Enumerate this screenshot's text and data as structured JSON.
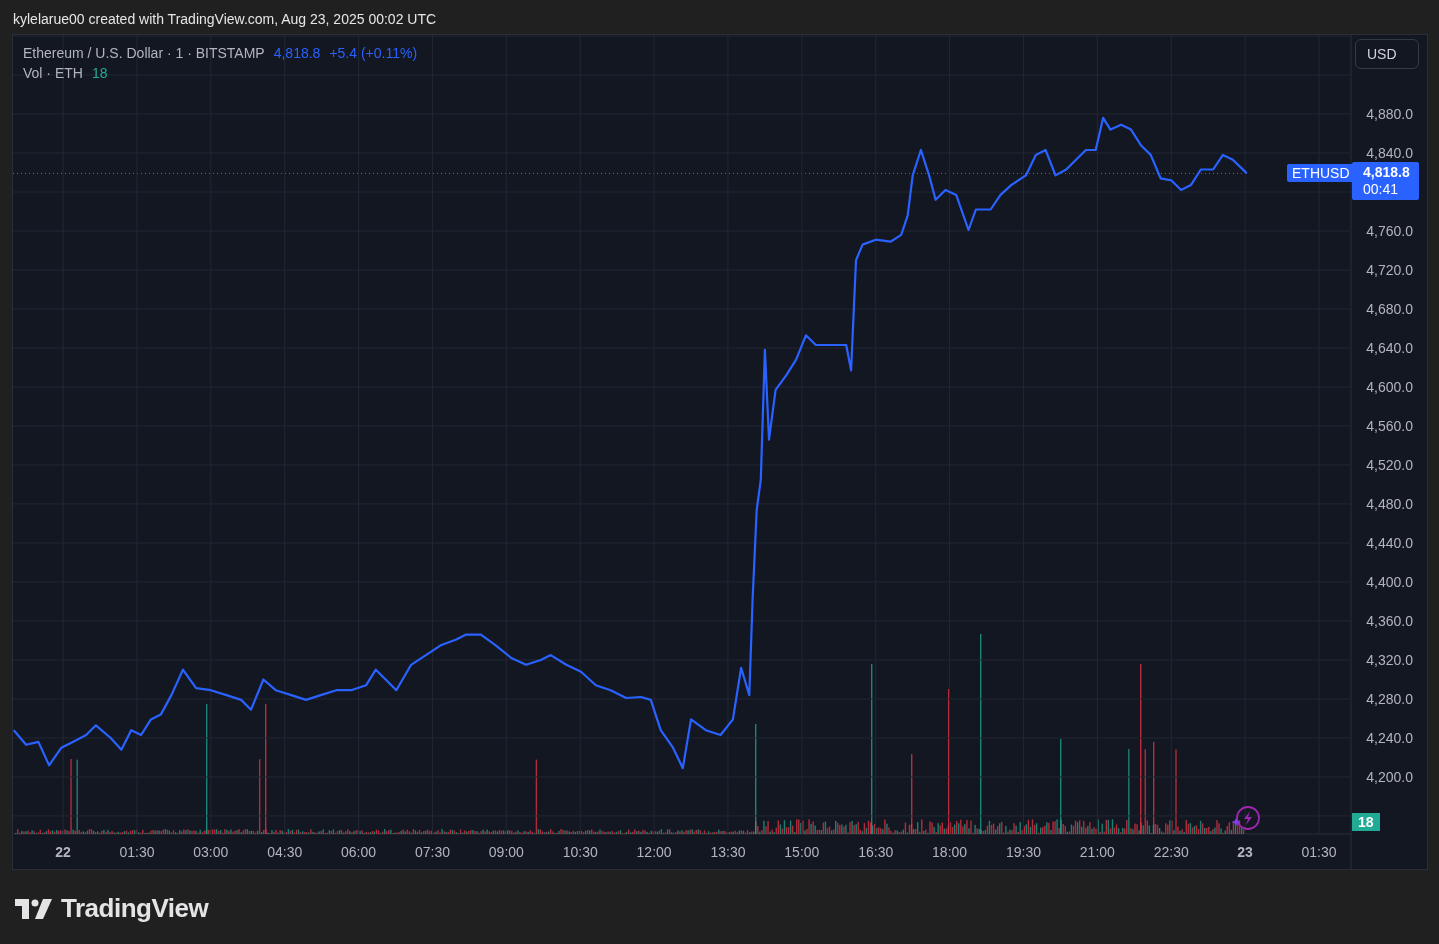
{
  "header": {
    "text": "kylelarue00 created with TradingView.com, Aug 23, 2025 00:02 UTC"
  },
  "legend": {
    "title": "Ethereum / U.S. Dollar · 1 · BITSTAMP",
    "price": "4,818.8",
    "change": "+5.4 (+0.11%)",
    "volume_label": "Vol · ETH",
    "volume_value": "18"
  },
  "currency_button": "USD",
  "price_line": {
    "price": "4,818.8",
    "countdown": "00:41"
  },
  "volume_badge": "18",
  "chart_data": {
    "type": "line",
    "grid": true,
    "xlim": [
      "2025-08-21T22:59",
      "2025-08-23T02:09"
    ],
    "ylim": [
      4141.5,
      4961
    ],
    "xticks": [
      {
        "value": "2025-08-22T00:00",
        "label": "22"
      },
      {
        "value": "2025-08-22T01:30",
        "label": "01:30"
      },
      {
        "value": "2025-08-22T03:00",
        "label": "03:00"
      },
      {
        "value": "2025-08-22T04:30",
        "label": "04:30"
      },
      {
        "value": "2025-08-22T06:00",
        "label": "06:00"
      },
      {
        "value": "2025-08-22T07:30",
        "label": "07:30"
      },
      {
        "value": "2025-08-22T09:00",
        "label": "09:00"
      },
      {
        "value": "2025-08-22T10:30",
        "label": "10:30"
      },
      {
        "value": "2025-08-22T12:00",
        "label": "12:00"
      },
      {
        "value": "2025-08-22T13:30",
        "label": "13:30"
      },
      {
        "value": "2025-08-22T15:00",
        "label": "15:00"
      },
      {
        "value": "2025-08-22T16:30",
        "label": "16:30"
      },
      {
        "value": "2025-08-22T18:00",
        "label": "18:00"
      },
      {
        "value": "2025-08-22T19:30",
        "label": "19:30"
      },
      {
        "value": "2025-08-22T21:00",
        "label": "21:00"
      },
      {
        "value": "2025-08-22T22:30",
        "label": "22:30"
      },
      {
        "value": "2025-08-23T00:00",
        "label": "23"
      },
      {
        "value": "2025-08-23T01:30",
        "label": "01:30"
      }
    ],
    "yticks": [
      {
        "value": 4200,
        "label": "4,200.0"
      },
      {
        "value": 4240,
        "label": "4,240.0"
      },
      {
        "value": 4280,
        "label": "4,280.0"
      },
      {
        "value": 4320,
        "label": "4,320.0"
      },
      {
        "value": 4360,
        "label": "4,360.0"
      },
      {
        "value": 4400,
        "label": "4,400.0"
      },
      {
        "value": 4440,
        "label": "4,440.0"
      },
      {
        "value": 4480,
        "label": "4,480.0"
      },
      {
        "value": 4520,
        "label": "4,520.0"
      },
      {
        "value": 4560,
        "label": "4,560.0"
      },
      {
        "value": 4600,
        "label": "4,600.0"
      },
      {
        "value": 4640,
        "label": "4,640.0"
      },
      {
        "value": 4680,
        "label": "4,680.0"
      },
      {
        "value": 4720,
        "label": "4,720.0"
      },
      {
        "value": 4760,
        "label": "4,760.0"
      },
      {
        "value": 4840,
        "label": "4,840.0"
      },
      {
        "value": 4880,
        "label": "4,880.0"
      }
    ],
    "x": [
      "2025-08-21T23:00",
      "2025-08-21T23:15",
      "2025-08-21T23:30",
      "2025-08-21T23:43",
      "2025-08-21T23:58",
      "2025-08-22T00:12",
      "2025-08-22T00:28",
      "2025-08-22T00:40",
      "2025-08-22T00:58",
      "2025-08-22T01:11",
      "2025-08-22T01:23",
      "2025-08-22T01:35",
      "2025-08-22T01:47",
      "2025-08-22T01:59",
      "2025-08-22T02:12",
      "2025-08-22T02:26",
      "2025-08-22T02:42",
      "2025-08-22T03:00",
      "2025-08-22T03:19",
      "2025-08-22T03:37",
      "2025-08-22T03:49",
      "2025-08-22T04:04",
      "2025-08-22T04:19",
      "2025-08-22T04:38",
      "2025-08-22T04:56",
      "2025-08-22T05:14",
      "2025-08-22T05:33",
      "2025-08-22T05:51",
      "2025-08-22T06:09",
      "2025-08-22T06:21",
      "2025-08-22T06:33",
      "2025-08-22T06:46",
      "2025-08-22T07:04",
      "2025-08-22T07:22",
      "2025-08-22T07:40",
      "2025-08-22T07:59",
      "2025-08-22T08:11",
      "2025-08-22T08:29",
      "2025-08-22T08:47",
      "2025-08-22T09:06",
      "2025-08-22T09:24",
      "2025-08-22T09:42",
      "2025-08-22T09:54",
      "2025-08-22T10:13",
      "2025-08-22T10:31",
      "2025-08-22T10:49",
      "2025-08-22T11:07",
      "2025-08-22T11:26",
      "2025-08-22T11:44",
      "2025-08-22T11:56",
      "2025-08-22T12:08",
      "2025-08-22T12:23",
      "2025-08-22T12:35",
      "2025-08-22T12:45",
      "2025-08-22T13:03",
      "2025-08-22T13:21",
      "2025-08-22T13:36",
      "2025-08-22T13:46",
      "2025-08-22T13:56",
      "2025-08-22T14:00",
      "2025-08-22T14:05",
      "2025-08-22T14:10",
      "2025-08-22T14:15",
      "2025-08-22T14:20",
      "2025-08-22T14:28",
      "2025-08-22T14:41",
      "2025-08-22T14:53",
      "2025-08-22T15:05",
      "2025-08-22T15:17",
      "2025-08-22T15:35",
      "2025-08-22T15:54",
      "2025-08-22T16:00",
      "2025-08-22T16:06",
      "2025-08-22T16:14",
      "2025-08-22T16:30",
      "2025-08-22T16:48",
      "2025-08-22T17:01",
      "2025-08-22T17:09",
      "2025-08-22T17:15",
      "2025-08-22T17:25",
      "2025-08-22T17:35",
      "2025-08-22T17:43",
      "2025-08-22T17:55",
      "2025-08-22T18:08",
      "2025-08-22T18:23",
      "2025-08-22T18:32",
      "2025-08-22T18:50",
      "2025-08-22T19:02",
      "2025-08-22T19:15",
      "2025-08-22T19:33",
      "2025-08-22T19:45",
      "2025-08-22T19:57",
      "2025-08-22T20:09",
      "2025-08-22T20:22",
      "2025-08-22T20:34",
      "2025-08-22T20:46",
      "2025-08-22T20:58",
      "2025-08-22T21:07",
      "2025-08-22T21:16",
      "2025-08-22T21:29",
      "2025-08-22T21:41",
      "2025-08-22T21:53",
      "2025-08-22T22:05",
      "2025-08-22T22:17",
      "2025-08-22T22:30",
      "2025-08-22T22:42",
      "2025-08-22T22:54",
      "2025-08-22T23:06",
      "2025-08-22T23:21",
      "2025-08-22T23:33",
      "2025-08-22T23:45",
      "2025-08-22T23:55",
      "2025-08-23T00:02"
    ],
    "series": [
      {
        "name": "ETHUSD",
        "color": "#2962ff",
        "values": [
          4248,
          4233,
          4236,
          4212,
          4230,
          4236,
          4243,
          4253,
          4240,
          4228,
          4248,
          4243,
          4259,
          4264,
          4284,
          4310,
          4291,
          4289,
          4284,
          4279,
          4269,
          4300,
          4289,
          4284,
          4279,
          4284,
          4289,
          4289,
          4294,
          4310,
          4300,
          4289,
          4315,
          4325,
          4335,
          4341,
          4346,
          4346,
          4335,
          4322,
          4315,
          4320,
          4325,
          4315,
          4308,
          4294,
          4289,
          4281,
          4282,
          4279,
          4248,
          4230,
          4209,
          4259,
          4248,
          4243,
          4259,
          4312,
          4284,
          4382,
          4474,
          4505,
          4638,
          4546,
          4597,
          4612,
          4628,
          4653,
          4643,
          4643,
          4643,
          4617,
          4730,
          4746,
          4751,
          4749,
          4756,
          4776,
          4817,
          4843,
          4817,
          4792,
          4802,
          4797,
          4761,
          4782,
          4782,
          4797,
          4807,
          4817,
          4838,
          4843,
          4817,
          4823,
          4833,
          4843,
          4843,
          4876,
          4864,
          4869,
          4864,
          4848,
          4838,
          4814,
          4812,
          4802,
          4807,
          4823,
          4823,
          4838,
          4833,
          4825,
          4819
        ]
      }
    ]
  },
  "footer": {
    "logo_text": "TradingView"
  }
}
